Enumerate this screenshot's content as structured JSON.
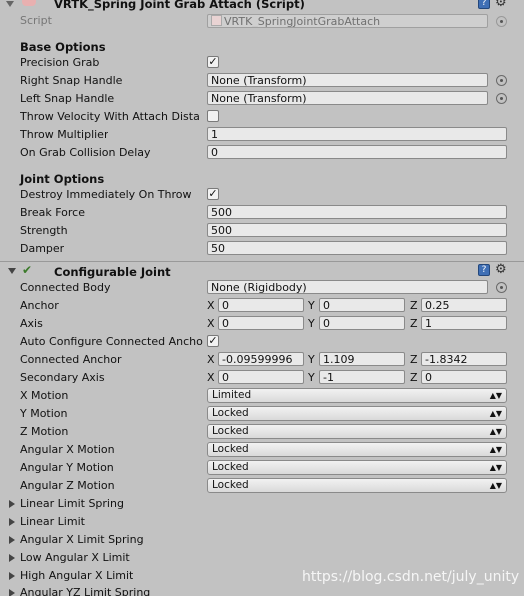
{
  "script_component": {
    "title": "VRTK_Spring Joint Grab Attach (Script)",
    "script_label": "Script",
    "script_value": "VRTK_SpringJointGrabAttach"
  },
  "base_options": {
    "title": "Base Options",
    "precision_grab_label": "Precision Grab",
    "right_snap_label": "Right Snap Handle",
    "right_snap_value": "None (Transform)",
    "left_snap_label": "Left Snap Handle",
    "left_snap_value": "None (Transform)",
    "throw_velocity_label": "Throw Velocity With Attach Dista",
    "throw_multiplier_label": "Throw Multiplier",
    "throw_multiplier_value": "1",
    "on_grab_delay_label": "On Grab Collision Delay",
    "on_grab_delay_value": "0"
  },
  "joint_options": {
    "title": "Joint Options",
    "destroy_label": "Destroy Immediately On Throw",
    "break_force_label": "Break Force",
    "break_force_value": "500",
    "strength_label": "Strength",
    "strength_value": "500",
    "damper_label": "Damper",
    "damper_value": "50"
  },
  "configurable_joint": {
    "title": "Configurable Joint",
    "connected_body_label": "Connected Body",
    "connected_body_value": "None (Rigidbody)",
    "anchor_label": "Anchor",
    "anchor": {
      "x": "0",
      "y": "0",
      "z": "0.25"
    },
    "axis_label": "Axis",
    "axis": {
      "x": "0",
      "y": "0",
      "z": "1"
    },
    "auto_configure_label": "Auto Configure Connected Ancho",
    "connected_anchor_label": "Connected Anchor",
    "connected_anchor": {
      "x": "-0.09599996",
      "y": "1.109",
      "z": "-1.8342"
    },
    "secondary_axis_label": "Secondary Axis",
    "secondary_axis": {
      "x": "0",
      "y": "-1",
      "z": "0"
    },
    "axis_letters": {
      "x": "X",
      "y": "Y",
      "z": "Z"
    },
    "x_motion_label": "X Motion",
    "x_motion_value": "Limited",
    "y_motion_label": "Y Motion",
    "y_motion_value": "Locked",
    "z_motion_label": "Z Motion",
    "z_motion_value": "Locked",
    "ang_x_motion_label": "Angular X Motion",
    "ang_x_motion_value": "Locked",
    "ang_y_motion_label": "Angular Y Motion",
    "ang_y_motion_value": "Locked",
    "ang_z_motion_label": "Angular Z Motion",
    "ang_z_motion_value": "Locked",
    "foldouts": [
      "Linear Limit Spring",
      "Linear Limit",
      "Angular X Limit Spring",
      "Low Angular X Limit",
      "High Angular X Limit",
      "Angular YZ Limit Spring"
    ]
  },
  "watermark": "https://blog.csdn.net/july_unity",
  "colors": {
    "background": "#c2c2c2",
    "field": "#e9e9e9",
    "accent": "#3f6fb5"
  }
}
